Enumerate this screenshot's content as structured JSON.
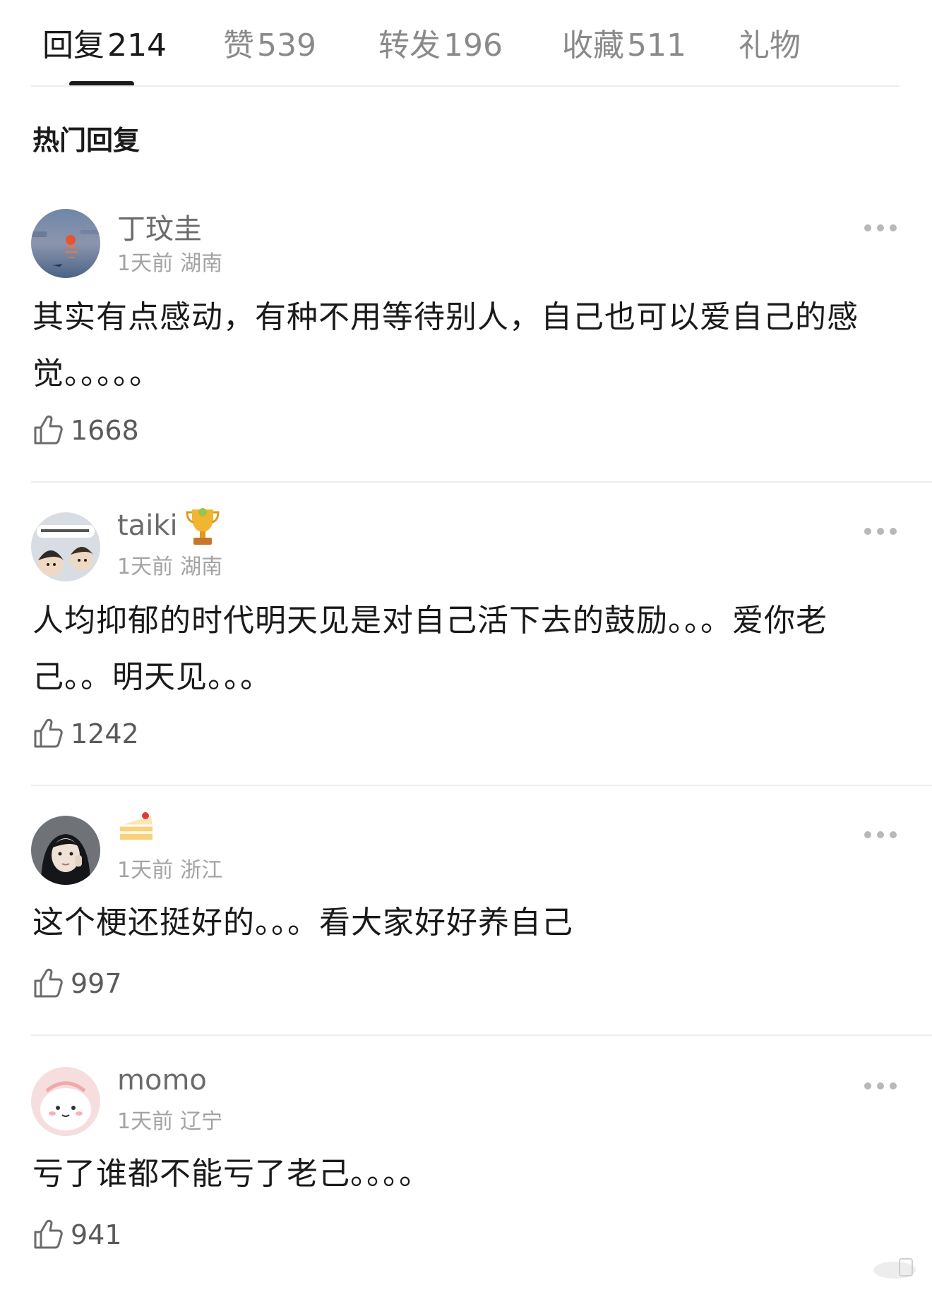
{
  "tabs": [
    {
      "label": "回复",
      "count": "214",
      "active": true
    },
    {
      "label": "赞",
      "count": "539"
    },
    {
      "label": "转发",
      "count": "196"
    },
    {
      "label": "收藏",
      "count": "511"
    },
    {
      "label": "礼物",
      "count": ""
    }
  ],
  "section_title": "热门回复",
  "comments": [
    {
      "username": "丁玟圭",
      "time": "1天前",
      "location": "湖南",
      "text": "其实有点感动，有种不用等待别人，自己也可以爱自己的感觉。。。。。",
      "likes": "1668",
      "avatar_icon": "sunrise-painting-avatar"
    },
    {
      "username": "taiki",
      "time": "1天前",
      "location": "湖南",
      "text": "人均抑郁的时代明天见是对自己活下去的鼓励。。。爱你老己。。明天见。。。",
      "likes": "1242",
      "avatar_icon": "cartoon-couple-avatar",
      "badge_icon": "trophy-icon"
    },
    {
      "username": "",
      "username_icon": "cake-slice-icon",
      "time": "1天前",
      "location": "浙江",
      "text": "这个梗还挺好的。。。看大家好好养自己",
      "likes": "997",
      "avatar_icon": "girl-photo-avatar"
    },
    {
      "username": "momo",
      "time": "1天前",
      "location": "辽宁",
      "text": "亏了谁都不能亏了老己。。。。",
      "likes": "941",
      "avatar_icon": "pink-cartoon-avatar"
    }
  ],
  "colors": {
    "primary_text": "#1a1a1a",
    "secondary_text": "#8a8a8a",
    "meta_text": "#a3a3a3",
    "divider": "#eeeeee"
  }
}
